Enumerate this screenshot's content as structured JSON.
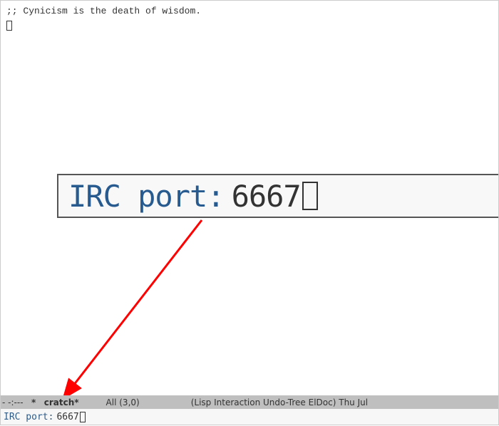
{
  "buffer": {
    "scratch_message": ";; Cynicism is the death of wisdom."
  },
  "magnified": {
    "prompt": "IRC port:",
    "value": "6667"
  },
  "mode_line": {
    "coding": "-",
    "modified": "-:---",
    "buffer_name_prefix": "*",
    "buffer_name_visible": "cratch*",
    "position": "All",
    "line_col": "(3,0)",
    "modes": "(Lisp Interaction Undo-Tree ElDoc)",
    "datetime": "Thu Jul"
  },
  "minibuffer": {
    "prompt": "IRC port:",
    "value": "6667"
  }
}
